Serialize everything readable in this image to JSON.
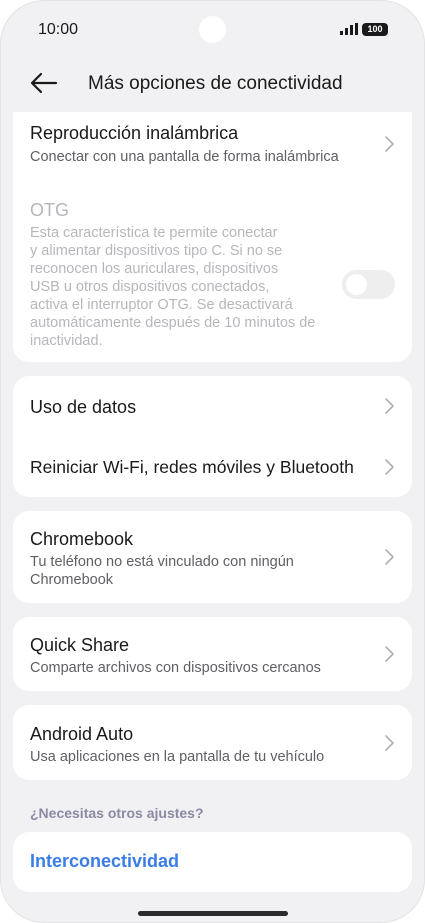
{
  "status_bar": {
    "time": "10:00",
    "battery": "100"
  },
  "header": {
    "title": "Más opciones de conectividad"
  },
  "wireless_display": {
    "title": "Reproducción inalámbrica",
    "subtitle": "Conectar con una pantalla de forma inalámbrica"
  },
  "otg": {
    "title": "OTG",
    "lines": [
      "Esta característica te permite conectar",
      "y alimentar dispositivos tipo C. Si no se",
      "reconocen los auriculares, dispositivos",
      "USB u otros dispositivos conectados,",
      "activa el interruptor OTG. Se desactivará",
      "automáticamente después de 10 minutos de",
      "inactividad."
    ],
    "enabled": false
  },
  "data_usage": {
    "title": "Uso de datos"
  },
  "reset": {
    "title": "Reiniciar Wi-Fi, redes móviles y Bluetooth"
  },
  "chromebook": {
    "title": "Chromebook",
    "lines": [
      "Tu teléfono no está vinculado con ningún",
      "Chromebook"
    ]
  },
  "quick_share": {
    "title": "Quick Share",
    "subtitle": "Comparte archivos con dispositivos cercanos"
  },
  "android_auto": {
    "title": "Android Auto",
    "subtitle": "Usa aplicaciones en la pantalla de tu vehículo"
  },
  "other_settings": {
    "label": "¿Necesitas otros ajustes?",
    "link": "Interconectividad"
  },
  "colors": {
    "accent": "#3a7de6",
    "background": "#f1f1f3",
    "card": "#ffffff"
  },
  "icons": {
    "back": "arrow-left-icon",
    "chevron": "chevron-right-icon"
  }
}
